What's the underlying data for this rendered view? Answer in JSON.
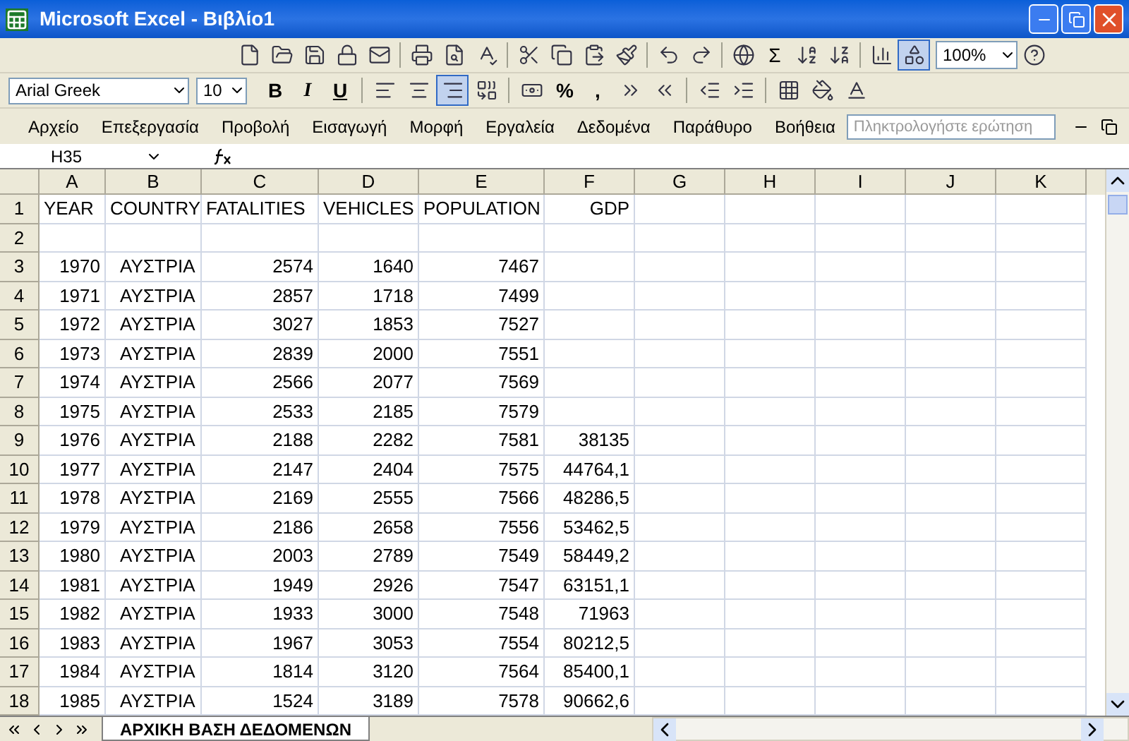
{
  "window": {
    "title": "Microsoft Excel - Βιβλίο1"
  },
  "standard_toolbar": [
    {
      "kind": "new"
    },
    {
      "kind": "open"
    },
    {
      "kind": "save"
    },
    {
      "kind": "permission"
    },
    {
      "kind": "email"
    },
    {
      "kind": "sep"
    },
    {
      "kind": "print"
    },
    {
      "kind": "preview"
    },
    {
      "kind": "spell"
    },
    {
      "kind": "sep"
    },
    {
      "kind": "cut"
    },
    {
      "kind": "copy"
    },
    {
      "kind": "paste"
    },
    {
      "kind": "painter"
    },
    {
      "kind": "sep"
    },
    {
      "kind": "undo"
    },
    {
      "kind": "redo"
    },
    {
      "kind": "sep"
    },
    {
      "kind": "globe"
    },
    {
      "kind": "text",
      "label": "Σ"
    },
    {
      "kind": "sortasc"
    },
    {
      "kind": "sortdesc"
    },
    {
      "kind": "sep"
    },
    {
      "kind": "chart"
    },
    {
      "kind": "drawing",
      "pressed": true
    },
    {
      "kind": "zoom",
      "label": "100%"
    },
    {
      "kind": "help"
    }
  ],
  "format_toolbar": {
    "font": "Arial Greek",
    "size": "10",
    "buttons": [
      {
        "kind": "bold",
        "label": "B"
      },
      {
        "kind": "italic",
        "label": "I"
      },
      {
        "kind": "underline",
        "label": "U"
      },
      {
        "kind": "sep"
      },
      {
        "kind": "alignleft"
      },
      {
        "kind": "aligncenter"
      },
      {
        "kind": "alignright",
        "pressed": true
      },
      {
        "kind": "merge"
      },
      {
        "kind": "sep"
      },
      {
        "kind": "currency"
      },
      {
        "kind": "bold",
        "label": "%"
      },
      {
        "kind": "bold",
        "label": ","
      },
      {
        "kind": "incdec"
      },
      {
        "kind": "decdec"
      },
      {
        "kind": "sep"
      },
      {
        "kind": "outdent"
      },
      {
        "kind": "indent"
      },
      {
        "kind": "sep"
      },
      {
        "kind": "borders"
      },
      {
        "kind": "fill"
      },
      {
        "kind": "fontcolor"
      }
    ]
  },
  "menu": [
    "Αρχείο",
    "Επεξεργασία",
    "Προβολή",
    "Εισαγωγή",
    "Μορφή",
    "Εργαλεία",
    "Δεδομένα",
    "Παράθυρο",
    "Βοήθεια"
  ],
  "question_box": {
    "placeholder": "Πληκτρολογήστε ερώτηση"
  },
  "name_box": "H35",
  "columns": [
    "A",
    "B",
    "C",
    "D",
    "E",
    "F",
    "G",
    "H",
    "I",
    "J",
    "K"
  ],
  "rows": [
    {
      "num": "1",
      "cells": [
        "YEAR",
        "COUNTRY",
        "FATALITIES",
        "VEHICLES",
        "POPULATION",
        "GDP"
      ]
    },
    {
      "num": "2"
    },
    {
      "num": "3",
      "cells": [
        "1970",
        "ΑΥΣΤΡΙΑ",
        "2574",
        "1640",
        "7467"
      ]
    },
    {
      "num": "4",
      "cells": [
        "1971",
        "ΑΥΣΤΡΙΑ",
        "2857",
        "1718",
        "7499"
      ]
    },
    {
      "num": "5",
      "cells": [
        "1972",
        "ΑΥΣΤΡΙΑ",
        "3027",
        "1853",
        "7527"
      ]
    },
    {
      "num": "6",
      "cells": [
        "1973",
        "ΑΥΣΤΡΙΑ",
        "2839",
        "2000",
        "7551"
      ]
    },
    {
      "num": "7",
      "cells": [
        "1974",
        "ΑΥΣΤΡΙΑ",
        "2566",
        "2077",
        "7569"
      ]
    },
    {
      "num": "8",
      "cells": [
        "1975",
        "ΑΥΣΤΡΙΑ",
        "2533",
        "2185",
        "7579"
      ]
    },
    {
      "num": "9",
      "cells": [
        "1976",
        "ΑΥΣΤΡΙΑ",
        "2188",
        "2282",
        "7581",
        "38135"
      ]
    },
    {
      "num": "10",
      "cells": [
        "1977",
        "ΑΥΣΤΡΙΑ",
        "2147",
        "2404",
        "7575",
        "44764,1"
      ]
    },
    {
      "num": "11",
      "cells": [
        "1978",
        "ΑΥΣΤΡΙΑ",
        "2169",
        "2555",
        "7566",
        "48286,5"
      ]
    },
    {
      "num": "12",
      "cells": [
        "1979",
        "ΑΥΣΤΡΙΑ",
        "2186",
        "2658",
        "7556",
        "53462,5"
      ]
    },
    {
      "num": "13",
      "cells": [
        "1980",
        "ΑΥΣΤΡΙΑ",
        "2003",
        "2789",
        "7549",
        "58449,2"
      ]
    },
    {
      "num": "14",
      "cells": [
        "1981",
        "ΑΥΣΤΡΙΑ",
        "1949",
        "2926",
        "7547",
        "63151,1"
      ]
    },
    {
      "num": "15",
      "cells": [
        "1982",
        "ΑΥΣΤΡΙΑ",
        "1933",
        "3000",
        "7548",
        "71963"
      ]
    },
    {
      "num": "16",
      "cells": [
        "1983",
        "ΑΥΣΤΡΙΑ",
        "1967",
        "3053",
        "7554",
        "80212,5"
      ]
    },
    {
      "num": "17",
      "cells": [
        "1984",
        "ΑΥΣΤΡΙΑ",
        "1814",
        "3120",
        "7564",
        "85400,1"
      ]
    },
    {
      "num": "18",
      "cells": [
        "1985",
        "ΑΥΣΤΡΙΑ",
        "1524",
        "3189",
        "7578",
        "90662,6"
      ]
    }
  ],
  "sheet_tabs": [
    {
      "label": "ΑΡΧΙΚΗ ΒΑΣΗ ΔΕΔΟΜΕΝΩΝ",
      "selected": true
    }
  ]
}
